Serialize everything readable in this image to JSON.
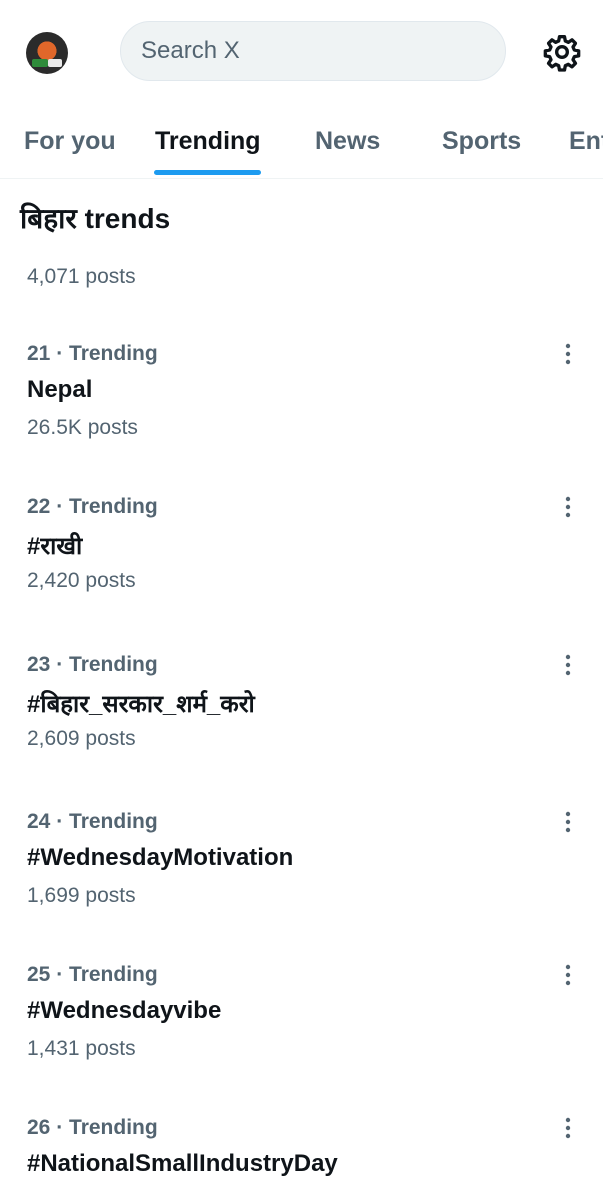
{
  "search": {
    "placeholder": "Search X"
  },
  "tabs": [
    {
      "label": "For you"
    },
    {
      "label": "Trending"
    },
    {
      "label": "News"
    },
    {
      "label": "Sports"
    },
    {
      "label": "Ent"
    }
  ],
  "section": {
    "title": "बिहार trends",
    "posts": "4,071 posts"
  },
  "trends": [
    {
      "meta": "21 · Trending",
      "name": "Nepal",
      "posts": "26.5K posts"
    },
    {
      "meta": "22 · Trending",
      "name": "#राखी",
      "posts": "2,420 posts"
    },
    {
      "meta": "23 · Trending",
      "name": "#बिहार_सरकार_शर्म_करो",
      "posts": "2,609 posts"
    },
    {
      "meta": "24 · Trending",
      "name": "#WednesdayMotivation",
      "posts": "1,699 posts"
    },
    {
      "meta": "25 · Trending",
      "name": "#Wednesdayvibe",
      "posts": "1,431 posts"
    },
    {
      "meta": "26 · Trending",
      "name": "#NationalSmallIndustryDay",
      "posts": ""
    }
  ],
  "colors": {
    "accent": "#1d9bf0",
    "secondary_text": "#536471",
    "primary_text": "#0f1419"
  },
  "icons": {
    "settings": "gear-icon",
    "more": "more-vertical-icon"
  }
}
